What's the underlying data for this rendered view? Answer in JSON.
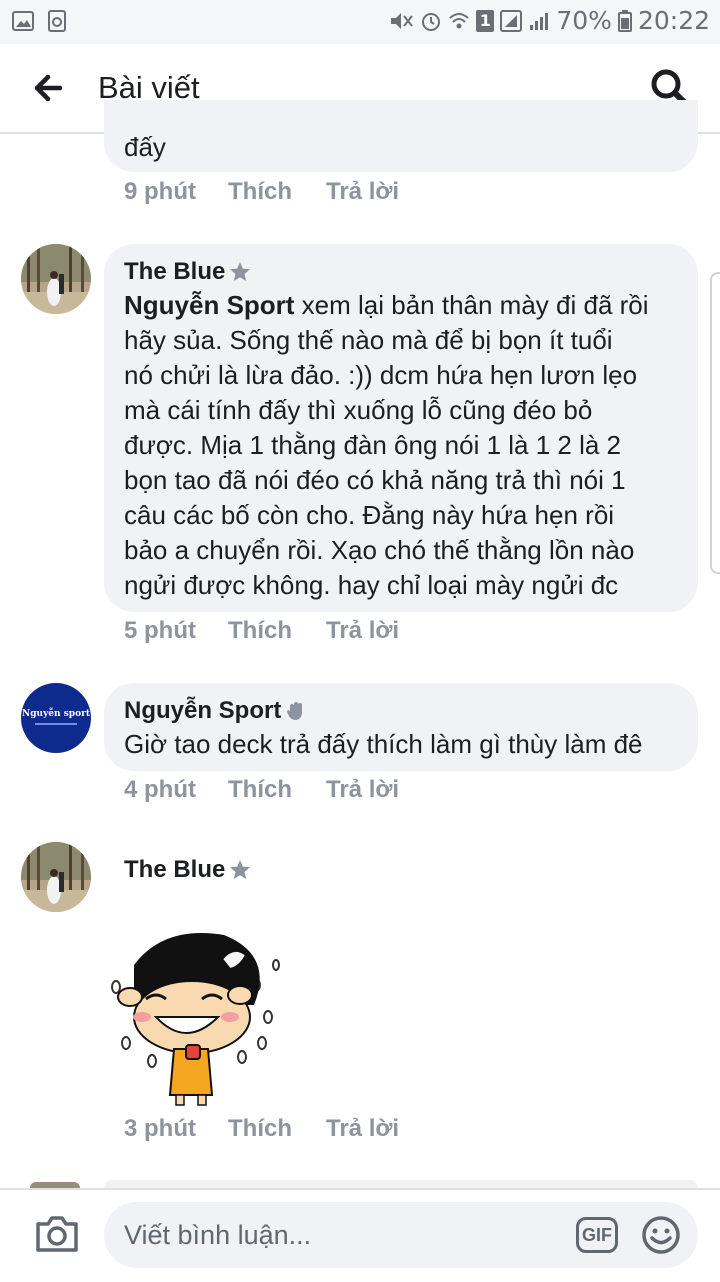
{
  "status_bar": {
    "battery_percent": "70%",
    "time": "20:22",
    "sim_slot": "1"
  },
  "header": {
    "title": "Bài viết"
  },
  "comments": [
    {
      "text": "đấy",
      "time": "9 phút",
      "like_label": "Thích",
      "reply_label": "Trả lời"
    },
    {
      "author": "The Blue",
      "mention": "Nguyễn Sport",
      "text_lines": [
        " xem lại bản thân mày đi đã rồi",
        "hãy sủa. Sống thế nào mà để bị bọn ít tuổi",
        "nó chửi là lừa đảo. :)) dcm hứa hẹn lươn lẹo",
        "mà cái tính đấy thì  xuống lỗ cũng đéo bỏ",
        "được. Mịa 1 thằng đàn ông nói 1 là 1 2 là 2",
        "bọn tao đã nói đéo có khả năng trả thì nói 1",
        "câu các bố còn cho. Đằng này hứa hẹn rồi",
        "bảo a chuyển rồi. Xạo chó thế thằng lồn nào",
        "ngửi được không. hay chỉ loại mày ngửi đc"
      ],
      "time": "5 phút",
      "like_label": "Thích",
      "reply_label": "Trả lời"
    },
    {
      "author": "Nguyễn Sport",
      "avatar_text": "Nguyễn sport",
      "text": "Giờ tao deck trả đấy thích làm gì thùy làm đê",
      "time": "4 phút",
      "like_label": "Thích",
      "reply_label": "Trả lời"
    },
    {
      "author": "The Blue",
      "sticker": "laughing-cartoon-sticker",
      "time": "3 phút",
      "like_label": "Thích",
      "reply_label": "Trả lời"
    }
  ],
  "composer": {
    "placeholder": "Viết bình luận...",
    "gif_label": "GIF"
  },
  "colors": {
    "bubble": "#f0f2f5",
    "meta_text": "#8d949e",
    "text": "#1c1e21",
    "sticker_yellow": "#f5a623",
    "avatar_blue": "#0d2a8c"
  }
}
